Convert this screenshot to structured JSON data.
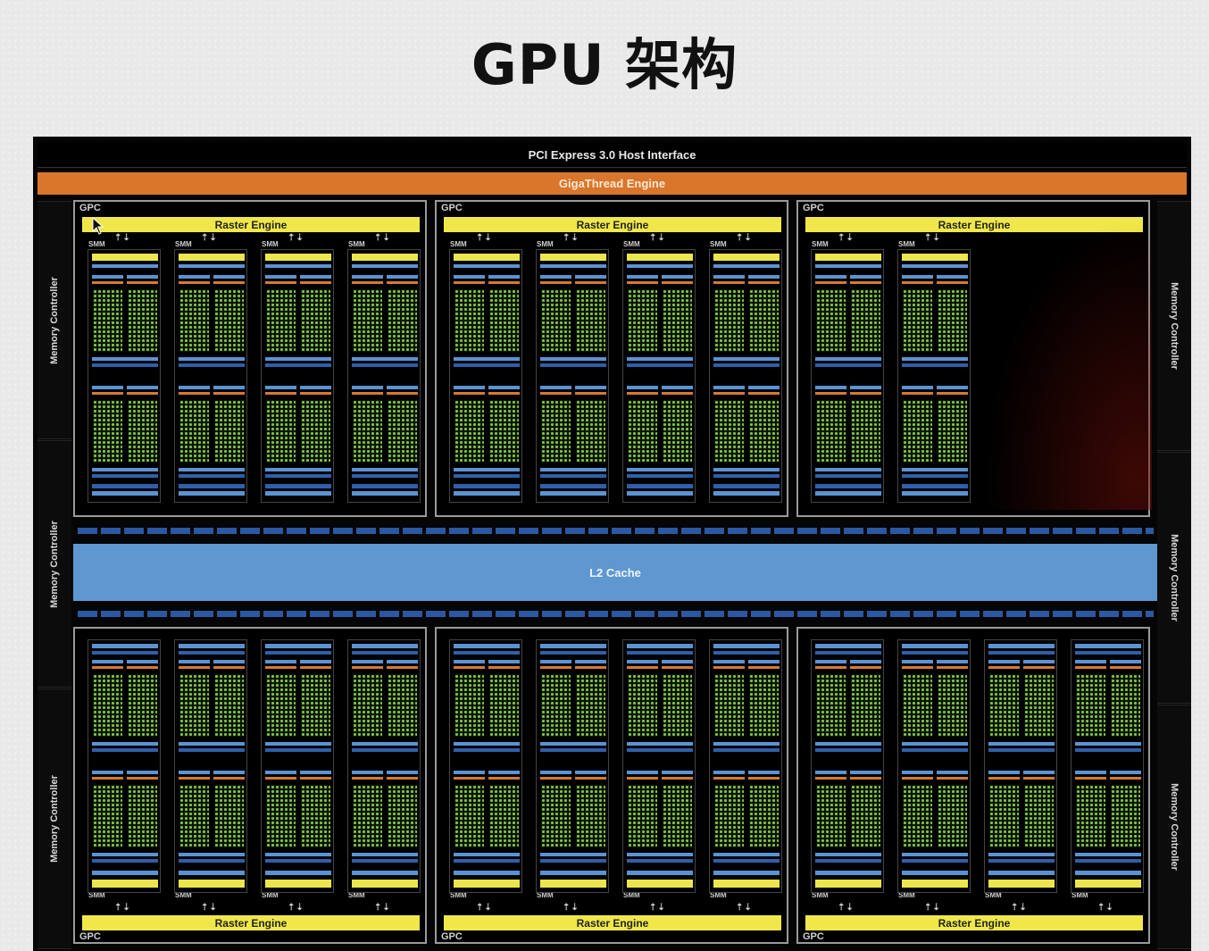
{
  "slide": {
    "title": "GPU 架构"
  },
  "diagram": {
    "pcie_label": "PCI Express 3.0 Host Interface",
    "gigathread_label": "GigaThread Engine",
    "l2_label": "L2 Cache",
    "memory_controller_label": "Memory Controller",
    "gpc_label": "GPC",
    "raster_label": "Raster Engine",
    "smm_label": "SMM",
    "arrow_glyph": "⇡⇣",
    "top_gpcs": [
      {
        "smm_count": 4
      },
      {
        "smm_count": 4
      },
      {
        "smm_count": 2
      }
    ],
    "bottom_gpcs": [
      {
        "smm_count": 4
      },
      {
        "smm_count": 4
      },
      {
        "smm_count": 4
      }
    ],
    "colors": {
      "raster_engine": "#f0e84a",
      "gigathread": "#d9762c",
      "l2_cache": "#5f97d0",
      "cuda_core": "#7fc244",
      "background": "#050505"
    }
  }
}
